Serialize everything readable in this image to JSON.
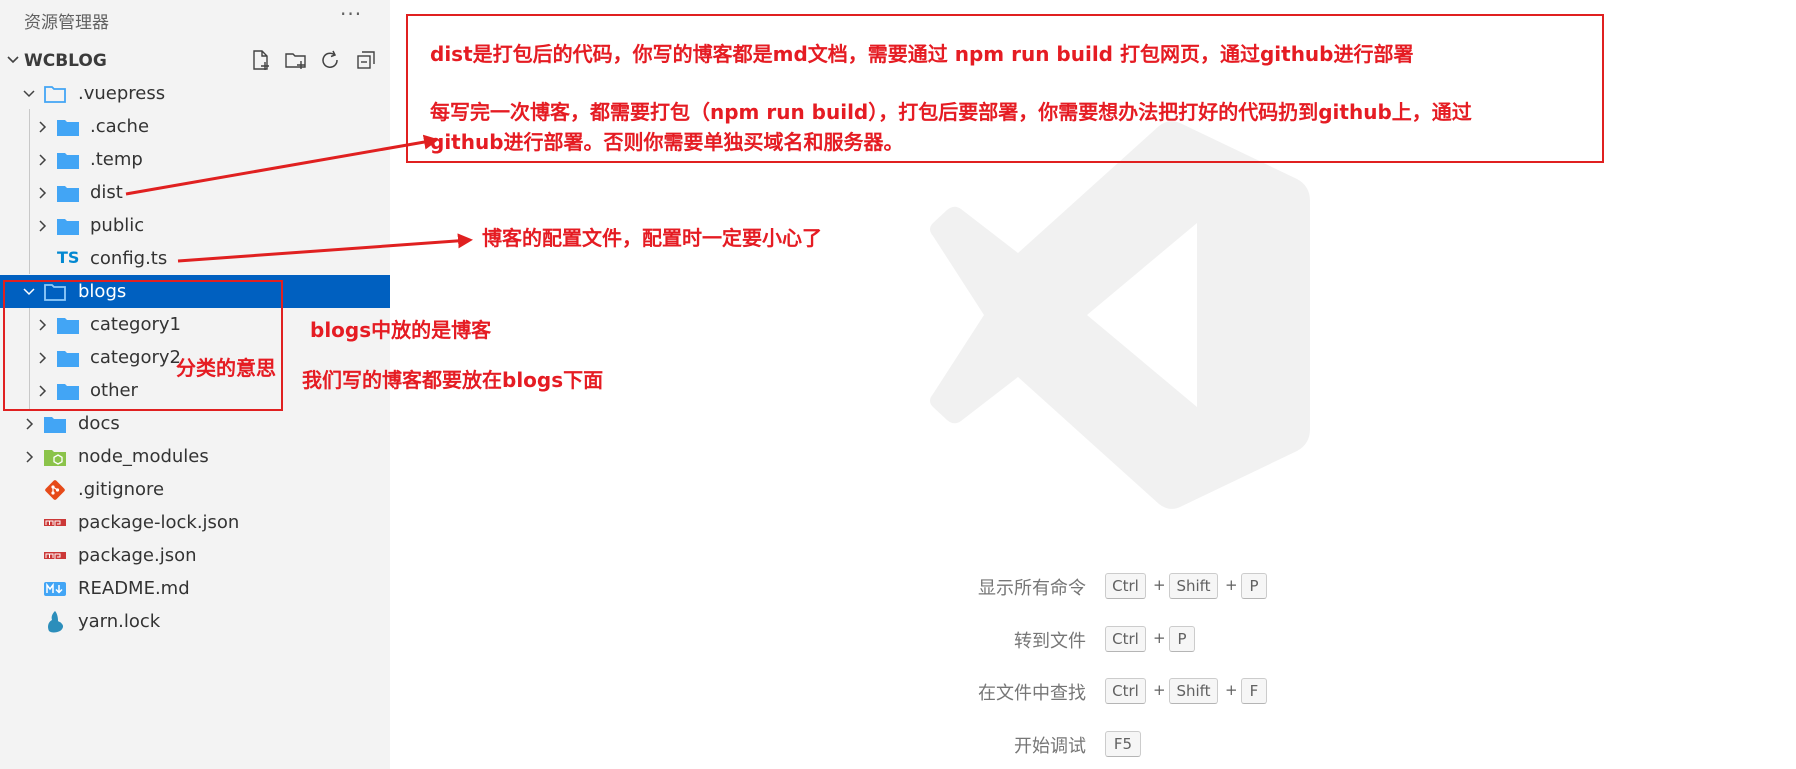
{
  "sidebar": {
    "title": "资源管理器",
    "more_label": "···",
    "workspace": {
      "name": "WCBLOG",
      "actions": [
        "new-file-icon",
        "new-folder-icon",
        "refresh-icon",
        "collapse-all-icon"
      ]
    },
    "tree": [
      {
        "label": ".vuepress",
        "icon": "folder-outline-icon",
        "expanded": true,
        "selected": false
      },
      {
        "label": ".cache",
        "icon": "folder-icon",
        "expanded": false,
        "selected": false
      },
      {
        "label": ".temp",
        "icon": "folder-icon",
        "expanded": false,
        "selected": false
      },
      {
        "label": "dist",
        "icon": "folder-icon",
        "expanded": false,
        "selected": false
      },
      {
        "label": "public",
        "icon": "folder-icon",
        "expanded": false,
        "selected": false
      },
      {
        "label": "config.ts",
        "icon": "typescript-file-icon",
        "icon_text": "TS",
        "selected": false
      },
      {
        "label": "blogs",
        "icon": "folder-outline-icon",
        "expanded": true,
        "selected": true
      },
      {
        "label": "category1",
        "icon": "folder-icon",
        "expanded": false,
        "selected": false
      },
      {
        "label": "category2",
        "icon": "folder-icon",
        "expanded": false,
        "selected": false
      },
      {
        "label": "other",
        "icon": "folder-icon",
        "expanded": false,
        "selected": false
      },
      {
        "label": "docs",
        "icon": "folder-icon",
        "expanded": false,
        "selected": false
      },
      {
        "label": "node_modules",
        "icon": "node-folder-icon",
        "expanded": false,
        "selected": false
      },
      {
        "label": ".gitignore",
        "icon": "git-file-icon",
        "selected": false
      },
      {
        "label": "package-lock.json",
        "icon": "npm-file-icon",
        "selected": false
      },
      {
        "label": "package.json",
        "icon": "npm-file-icon",
        "selected": false
      },
      {
        "label": "README.md",
        "icon": "markdown-file-icon",
        "selected": false
      },
      {
        "label": "yarn.lock",
        "icon": "yarn-file-icon",
        "selected": false
      }
    ]
  },
  "editor": {
    "watermark": "vscode-logo-icon",
    "hints": [
      {
        "label": "显示所有命令",
        "keys": [
          "Ctrl",
          "Shift",
          "P"
        ]
      },
      {
        "label": "转到文件",
        "keys": [
          "Ctrl",
          "P"
        ]
      },
      {
        "label": "在文件中查找",
        "keys": [
          "Ctrl",
          "Shift",
          "F"
        ]
      },
      {
        "label": "开始调试",
        "keys": [
          "F5"
        ]
      }
    ],
    "key_separator": "+"
  },
  "annotations": {
    "box_line1": "dist是打包后的代码，你写的博客都是md文档，需要通过  npm run build  打包网页，通过github进行部署",
    "box_line2": "每写完一次博客，都需要打包（npm run build），打包后要部署，你需要想办法把打好的代码扔到github上，通过",
    "box_line3": "github进行部署。否则你需要单独买域名和服务器。",
    "config_note": "博客的配置文件，配置时一定要小心了",
    "blogs_note": "blogs中放的是博客",
    "category_note": "分类的意思",
    "write_note": "我们写的博客都要放在blogs下面"
  },
  "colors": {
    "annotation": "#e51c23",
    "selection": "#0060c0",
    "folder": "#42a5f5",
    "sidebar_bg": "#f3f3f3"
  }
}
